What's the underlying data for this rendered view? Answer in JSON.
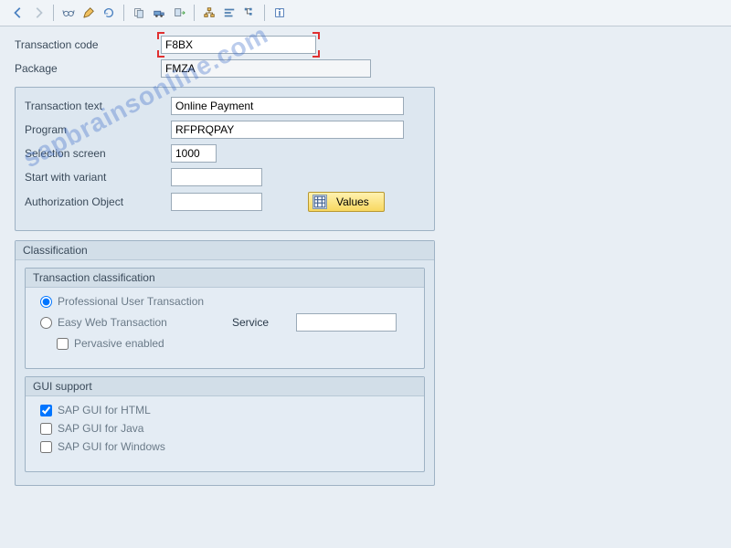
{
  "toolbar": {
    "icons": [
      "back",
      "forward",
      "sep",
      "glasses",
      "edit",
      "refresh",
      "sep",
      "copy",
      "transport",
      "paste",
      "sep",
      "hierarchy",
      "align",
      "tree",
      "sep",
      "info"
    ]
  },
  "header": {
    "tcode_label": "Transaction code",
    "tcode_value": "F8BX",
    "package_label": "Package",
    "package_value": "FMZA"
  },
  "details": {
    "text_label": "Transaction text",
    "text_value": "Online Payment",
    "program_label": "Program",
    "program_value": "RFPRQPAY",
    "selscreen_label": "Selection screen",
    "selscreen_value": "1000",
    "variant_label": "Start with variant",
    "variant_value": "",
    "authobj_label": "Authorization Object",
    "authobj_value": "",
    "values_btn": "Values"
  },
  "classification": {
    "title": "Classification",
    "tclass_title": "Transaction classification",
    "pro_label": "Professional User Transaction",
    "easy_label": "Easy Web Transaction",
    "service_label": "Service",
    "service_value": "",
    "pervasive_label": "Pervasive enabled",
    "gui_title": "GUI support",
    "gui_html": "SAP GUI for HTML",
    "gui_java": "SAP GUI for Java",
    "gui_win": "SAP GUI for Windows"
  },
  "watermark": "sapbrainsonline.com"
}
